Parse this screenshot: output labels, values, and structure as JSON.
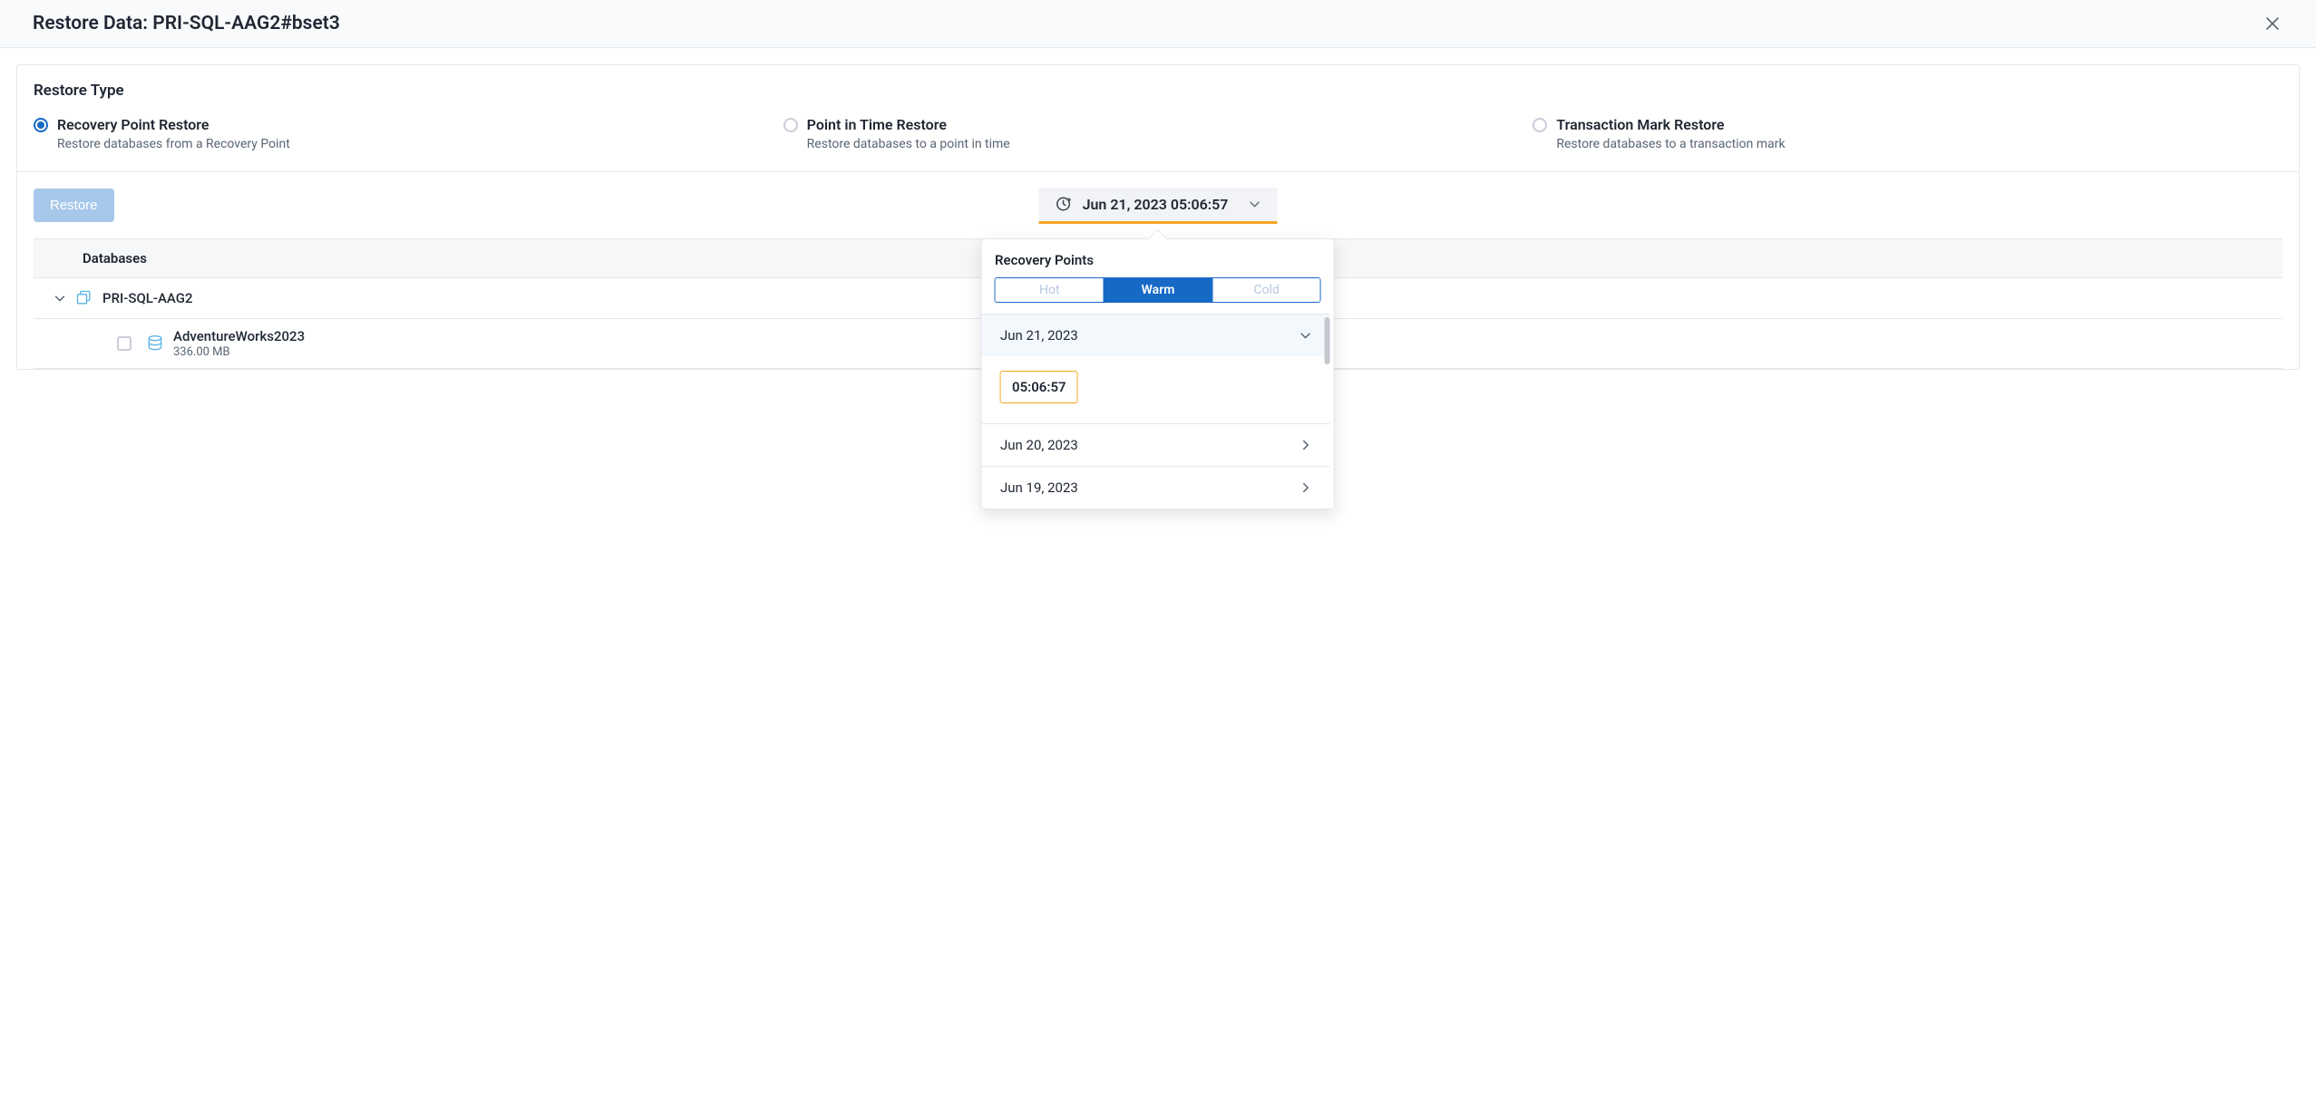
{
  "header": {
    "title": "Restore Data: PRI-SQL-AAG2#bset3"
  },
  "restore_type": {
    "title": "Restore Type",
    "options": [
      {
        "label": "Recovery Point Restore",
        "sub": "Restore databases from a Recovery Point",
        "selected": true
      },
      {
        "label": "Point in Time Restore",
        "sub": "Restore databases to a point in time",
        "selected": false
      },
      {
        "label": "Transaction Mark Restore",
        "sub": "Restore databases to a transaction mark",
        "selected": false
      }
    ]
  },
  "actions": {
    "restore_label": "Restore"
  },
  "recovery_trigger": {
    "label": "Jun 21, 2023 05:06:57"
  },
  "databases": {
    "header": "Databases",
    "server": "PRI-SQL-AAG2",
    "items": [
      {
        "name": "AdventureWorks2023",
        "size": "336.00 MB"
      }
    ]
  },
  "popover": {
    "title": "Recovery Points",
    "tiers": [
      "Hot",
      "Warm",
      "Cold"
    ],
    "active_tier": "Warm",
    "dates": [
      {
        "label": "Jun 21, 2023",
        "expanded": true,
        "times": [
          "05:06:57"
        ]
      },
      {
        "label": "Jun 20, 2023",
        "expanded": false
      },
      {
        "label": "Jun 19, 2023",
        "expanded": false
      }
    ]
  }
}
